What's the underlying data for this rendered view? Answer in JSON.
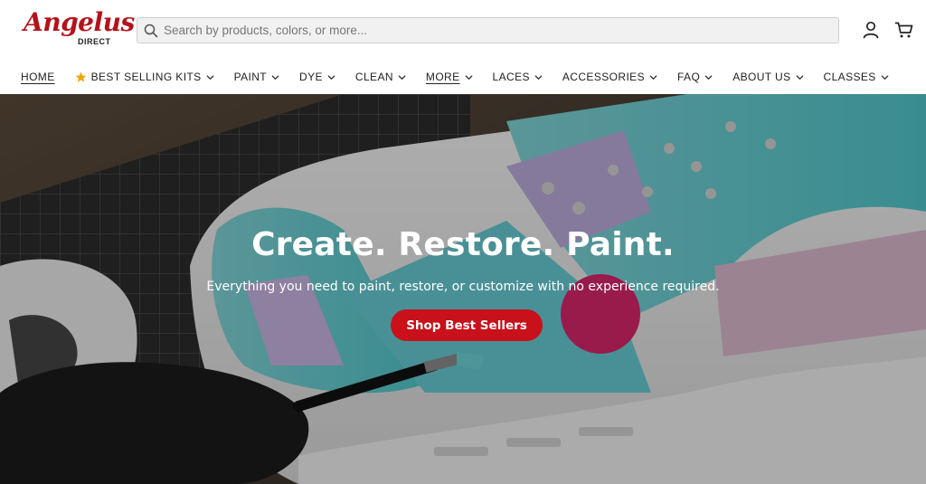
{
  "brand": {
    "logo_script": "Angelus",
    "logo_sub": "DIRECT"
  },
  "search": {
    "placeholder": "Search by products, colors, or more..."
  },
  "header_icons": {
    "account": "account-icon",
    "cart": "cart-icon"
  },
  "nav": {
    "items": [
      {
        "label": "HOME",
        "dropdown": false,
        "underline": true
      },
      {
        "label": "BEST SELLING KITS",
        "dropdown": true,
        "icon": "star-icon"
      },
      {
        "label": "PAINT",
        "dropdown": true
      },
      {
        "label": "DYE",
        "dropdown": true
      },
      {
        "label": "CLEAN",
        "dropdown": true
      },
      {
        "label": "MORE",
        "dropdown": true,
        "underline": true
      },
      {
        "label": "LACES",
        "dropdown": true
      },
      {
        "label": "ACCESSORIES",
        "dropdown": true
      },
      {
        "label": "FAQ",
        "dropdown": true
      },
      {
        "label": "ABOUT US",
        "dropdown": true
      },
      {
        "label": "CLASSES",
        "dropdown": true
      }
    ]
  },
  "hero": {
    "title": "Create. Restore. Paint.",
    "subtitle": "Everything you need to paint, restore, or customize with no experience required.",
    "cta_label": "Shop Best Sellers"
  },
  "colors": {
    "brand_red": "#b5121b",
    "cta_red": "#c8111b"
  }
}
